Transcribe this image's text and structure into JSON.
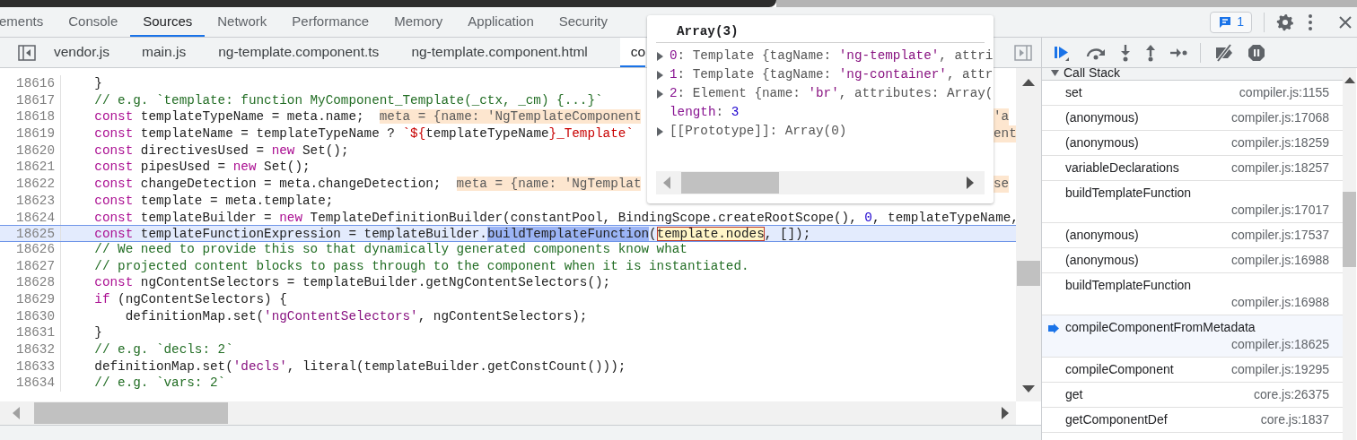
{
  "panel_tabs": [
    {
      "label": "ements",
      "selected": false
    },
    {
      "label": "Console",
      "selected": false
    },
    {
      "label": "Sources",
      "selected": true
    },
    {
      "label": "Network",
      "selected": false
    },
    {
      "label": "Performance",
      "selected": false
    },
    {
      "label": "Memory",
      "selected": false
    },
    {
      "label": "Application",
      "selected": false
    },
    {
      "label": "Security",
      "selected": false
    }
  ],
  "issues_badge": "1",
  "file_tabs": [
    {
      "label": "vendor.js",
      "selected": false
    },
    {
      "label": "main.js",
      "selected": false
    },
    {
      "label": "ng-template.component.ts",
      "selected": false
    },
    {
      "label": "ng-template.component.html",
      "selected": false
    },
    {
      "label": "co",
      "selected": true
    }
  ],
  "code_lines": [
    {
      "number": "18616",
      "current": false,
      "segments": [
        {
          "plain": "    }"
        }
      ]
    },
    {
      "number": "18617",
      "current": false,
      "segments": [
        {
          "comment": "    // e.g. `template: function MyComponent_Template(_ctx, _cm) {...}`"
        }
      ]
    },
    {
      "number": "18618",
      "current": false,
      "segments": [
        {
          "keyword": "    const"
        },
        {
          "plain": " templateTypeName = meta.name;  "
        },
        {
          "inline_value": "meta = {name: 'NgTemplateComponent"
        }
      ],
      "tail": "'a"
    },
    {
      "number": "18619",
      "current": false,
      "segments": [
        {
          "keyword": "    const"
        },
        {
          "plain": " templateName = templateTypeName ? "
        },
        {
          "template": "`${"
        },
        {
          "plain": "templateTypeName"
        },
        {
          "template": "}_Template`"
        }
      ],
      "tail": "ent"
    },
    {
      "number": "18620",
      "current": false,
      "segments": [
        {
          "keyword": "    const"
        },
        {
          "plain": " directivesUsed = "
        },
        {
          "keyword": "new"
        },
        {
          "plain": " Set();"
        }
      ]
    },
    {
      "number": "18621",
      "current": false,
      "segments": [
        {
          "keyword": "    const"
        },
        {
          "plain": " pipesUsed = "
        },
        {
          "keyword": "new"
        },
        {
          "plain": " Set();"
        }
      ]
    },
    {
      "number": "18622",
      "current": false,
      "segments": [
        {
          "keyword": "    const"
        },
        {
          "plain": " changeDetection = meta.changeDetection;  "
        },
        {
          "inline_value": "meta = {name: 'NgTemplat"
        }
      ],
      "tail": "se"
    },
    {
      "number": "18623",
      "current": false,
      "segments": [
        {
          "keyword": "    const"
        },
        {
          "plain": " template = meta.template;"
        }
      ]
    },
    {
      "number": "18624",
      "current": false,
      "segments": [
        {
          "keyword": "    const"
        },
        {
          "plain": " templateBuilder = "
        },
        {
          "keyword": "new"
        },
        {
          "plain": " TemplateDefinitionBuilder(constantPool, BindingScope.createRootScope(), "
        },
        {
          "number": "0"
        },
        {
          "plain": ", templateTypeName,"
        }
      ]
    },
    {
      "number": "18625",
      "current": true,
      "segments": [
        {
          "keyword": "    const"
        },
        {
          "plain": " templateFunctionExpression = templateBuilder."
        },
        {
          "selection": "buildTemplateFunction"
        },
        {
          "plain": "("
        },
        {
          "hover_target": "template.nodes"
        },
        {
          "plain": ", []);"
        }
      ]
    },
    {
      "number": "18626",
      "current": false,
      "segments": [
        {
          "comment": "    // We need to provide this so that dynamically generated components know what"
        }
      ]
    },
    {
      "number": "18627",
      "current": false,
      "segments": [
        {
          "comment": "    // projected content blocks to pass through to the component when it is instantiated."
        }
      ]
    },
    {
      "number": "18628",
      "current": false,
      "segments": [
        {
          "keyword": "    const"
        },
        {
          "plain": " ngContentSelectors = templateBuilder.getNgContentSelectors();"
        }
      ]
    },
    {
      "number": "18629",
      "current": false,
      "segments": [
        {
          "keyword": "    if"
        },
        {
          "plain": " (ngContentSelectors) {"
        }
      ]
    },
    {
      "number": "18630",
      "current": false,
      "segments": [
        {
          "plain": "        definitionMap.set("
        },
        {
          "string": "'ngContentSelectors'"
        },
        {
          "plain": ", ngContentSelectors);"
        }
      ]
    },
    {
      "number": "18631",
      "current": false,
      "segments": [
        {
          "plain": "    }"
        }
      ]
    },
    {
      "number": "18632",
      "current": false,
      "segments": [
        {
          "comment": "    // e.g. `decls: 2`"
        }
      ]
    },
    {
      "number": "18633",
      "current": false,
      "segments": [
        {
          "plain": "    definitionMap.set("
        },
        {
          "string": "'decls'"
        },
        {
          "plain": ", literal(templateBuilder.getConstCount()));"
        }
      ]
    },
    {
      "number": "18634",
      "current": false,
      "segments": [
        {
          "comment": "    // e.g. `vars: 2`"
        }
      ]
    }
  ],
  "hover_popup": {
    "title": "Array(3)",
    "rows": [
      {
        "expandable": true,
        "segments": [
          {
            "property_key": "0"
          },
          {
            "plain": ": Template {tagName: "
          },
          {
            "string": "'ng-template'"
          },
          {
            "plain": ", attri"
          }
        ]
      },
      {
        "expandable": true,
        "segments": [
          {
            "property_key": "1"
          },
          {
            "plain": ": Template {tagName: "
          },
          {
            "string": "'ng-container'"
          },
          {
            "plain": ", attr"
          }
        ]
      },
      {
        "expandable": true,
        "segments": [
          {
            "property_key": "2"
          },
          {
            "plain": ": Element {name: "
          },
          {
            "string": "'br'"
          },
          {
            "plain": ", attributes: Array("
          }
        ]
      },
      {
        "expandable": false,
        "segments": [
          {
            "property_key": "length"
          },
          {
            "plain": ": "
          },
          {
            "number": "3"
          }
        ]
      },
      {
        "expandable": true,
        "segments": [
          {
            "plain": "[[Prototype]]: Array(0)"
          }
        ]
      }
    ]
  },
  "call_stack": {
    "title": "Call Stack",
    "expanded": true,
    "frames": [
      {
        "name": "set",
        "location": "compiler.js:1155",
        "selected": false
      },
      {
        "name": "(anonymous)",
        "location": "compiler.js:17068",
        "selected": false
      },
      {
        "name": "(anonymous)",
        "location": "compiler.js:18259",
        "selected": false
      },
      {
        "name": "variableDeclarations",
        "location": "compiler.js:18257",
        "selected": false
      },
      {
        "name": "buildTemplateFunction",
        "location": "compiler.js:17017",
        "selected": false
      },
      {
        "name": "(anonymous)",
        "location": "compiler.js:17537",
        "selected": false
      },
      {
        "name": "(anonymous)",
        "location": "compiler.js:16988",
        "selected": false
      },
      {
        "name": "buildTemplateFunction",
        "location": "compiler.js:16988",
        "selected": false
      },
      {
        "name": "compileComponentFromMetadata",
        "location": "compiler.js:18625",
        "selected": true
      },
      {
        "name": "compileComponent",
        "location": "compiler.js:19295",
        "selected": false
      },
      {
        "name": "get",
        "location": "core.js:26375",
        "selected": false
      },
      {
        "name": "getComponentDef",
        "location": "core.js:1837",
        "selected": false
      }
    ]
  }
}
